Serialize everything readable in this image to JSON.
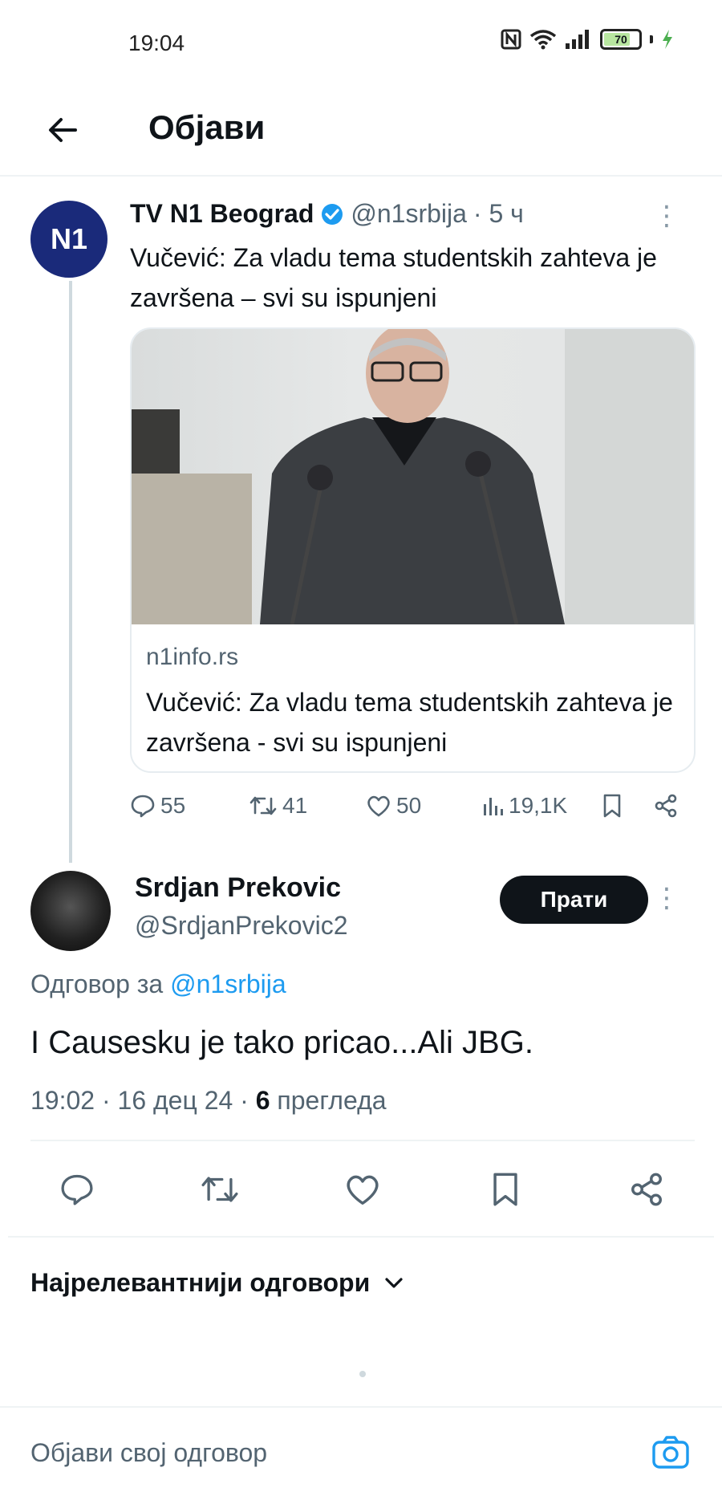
{
  "status_bar": {
    "time": "19:04",
    "battery_level": "70",
    "icons": [
      "nfc-icon",
      "wifi-icon",
      "signal-icon",
      "battery-icon",
      "charging-icon"
    ]
  },
  "header": {
    "title": "Објави",
    "back_icon": "arrow-left-icon"
  },
  "quoted_tweet": {
    "author_name": "TV N1 Beograd",
    "verified": true,
    "handle": "@n1srbija",
    "time_ago": "· 5 ч",
    "avatar_text": "N1",
    "text": "Vučević: Za vladu tema studentskih zahteva je završena – svi su ispunjeni",
    "card": {
      "domain": "n1info.rs",
      "title": "Vučević: Za vladu tema studentskih zahteva je završena - svi su ispunjeni"
    },
    "stats": {
      "replies": "55",
      "retweets": "41",
      "likes": "50",
      "views": "19,1K"
    }
  },
  "main_tweet": {
    "author_name": "Srdjan Prekovic",
    "handle": "@SrdjanPrekovic2",
    "follow_label": "Прати",
    "reply_prefix": "Одговор за ",
    "reply_to": "@n1srbija",
    "text": "I Causesku je tako pricao...Ali JBG.",
    "time": "19:02",
    "date": "16 дец 24",
    "views_count": "6",
    "views_label": "прегледа"
  },
  "replies": {
    "sort_label": "Најрелевантнији одговори"
  },
  "compose": {
    "placeholder": "Објави свој одговор"
  },
  "colors": {
    "accent": "#1d9bf0",
    "text": "#0f1419",
    "secondary": "#536471",
    "border": "#eff3f4",
    "battery_fill": "#b8e6a0",
    "charging": "#4caf50"
  }
}
